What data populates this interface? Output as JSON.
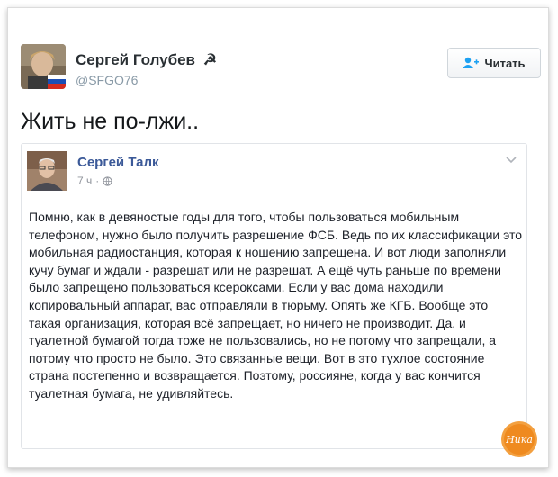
{
  "tweet": {
    "author_name": "Сергей Голубев",
    "author_badge": "☭",
    "author_handle": "@SFGO76",
    "follow_label": "Читать",
    "text": "Жить не по-лжи.."
  },
  "embedded_post": {
    "author_name": "Сергей Талк",
    "time": "7 ч",
    "separator": "·",
    "body": "Помню, как в девяностые годы для того, чтобы пользоваться мобильным телефоном, нужно было получить разрешение ФСБ. Ведь по их классификации это мобильная радиостанция, которая к ношению запрещена. И вот люди заполняли кучу бумаг и ждали - разрешат или не разрешат. А ещё чуть раньше по времени было запрещено пользоваться ксероксами. Если у вас дома находили копировальный аппарат, вас отправляли в тюрьму. Опять же КГБ. Вообще это такая организация, которая всё запрещает, но ничего не производит. Да, и туалетной бумагой тогда тоже не пользовались, но не потому что запрещали, а потому что просто не было. Это связанные вещи. Вот в это тухлое состояние страна постепенно и возвращается. Поэтому, россияне, когда у вас кончится туалетная бумага, не удивляйтесь."
  },
  "watermark": {
    "text": "Ника"
  },
  "colors": {
    "name_link": "#3b5998",
    "handle": "#8899a6",
    "follow_icon": "#1da1f2",
    "watermark": "#f08a24"
  },
  "icons": {
    "follow": "add-user-icon",
    "privacy": "globe-icon",
    "menu": "chevron-down-icon"
  }
}
